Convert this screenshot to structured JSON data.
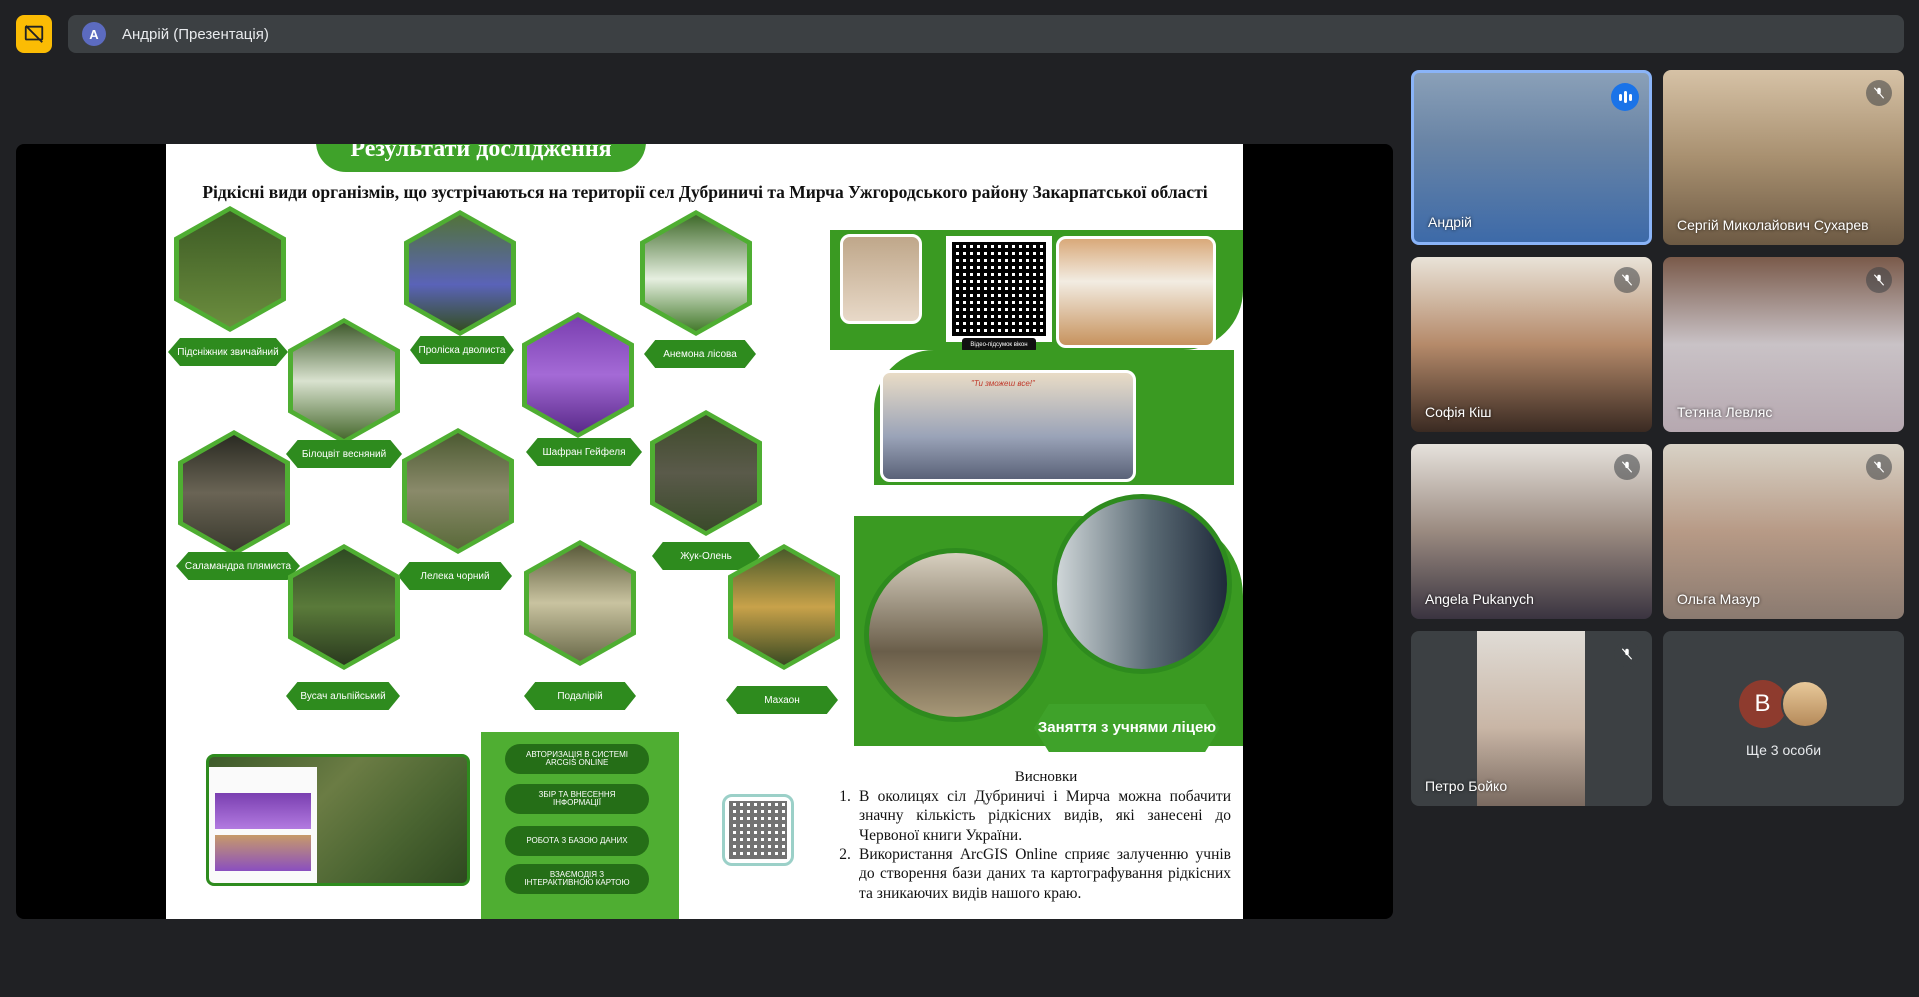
{
  "topbar": {
    "presenter_initial": "A",
    "presenter_label": "Андрій (Презентація)"
  },
  "slide": {
    "banner_text": "Результати дослідження",
    "title": "Рідкісні види організмів, що зустрічаються на території сел Дубриничі та Мирча Ужгородського району Закарпатської області",
    "species": [
      "Підсніжник звичайний",
      "Проліска дволиста",
      "Анемона лісова",
      "Білоцвіт весняний",
      "Шафран Гейфеля",
      "Саламандра плямиста",
      "Лелека чорний",
      "Жук-Олень",
      "Вусач альпійський",
      "Подалірій",
      "Махаон"
    ],
    "lesson_tag": "Заняття з учнями ліцею",
    "photo_caption": "\"Ти зможеш все!\"",
    "qr_caption": "Відео-підсумок вікон",
    "steps": [
      "АВТОРИЗАЦІЯ В СИСТЕМІ ARCGIS ONLINE",
      "ЗБІР ТА ВНЕСЕННЯ ІНФОРМАЦІЇ",
      "РОБОТА З БАЗОЮ ДАНИХ",
      "ВЗАЄМОДІЯ З ІНТЕРАКТИВНОЮ КАРТОЮ"
    ],
    "conclusions_title": "Висновки",
    "conclusions": [
      "В околицях сіл Дубриничі і Мирча можна побачити значну кількість рідкісних видів, які занесені до Червоної книги України.",
      "Використання ArcGIS Online сприяє залученню учнів до створення бази даних та картографування рідкісних та зникаючих видів нашого краю."
    ]
  },
  "participants": [
    {
      "name": "Андрій",
      "speaking": true
    },
    {
      "name": "Сергій Миколайович Сухарев",
      "muted": true
    },
    {
      "name": "Софія Кіш",
      "muted": true
    },
    {
      "name": "Тетяна Левляс",
      "muted": true
    },
    {
      "name": "Angela Pukanych",
      "muted": true
    },
    {
      "name": "Ольга Мазур",
      "muted": true
    },
    {
      "name": "Петро Бойко",
      "muted": true
    }
  ],
  "others": {
    "initial": "B",
    "label": "Ще 3 особи"
  },
  "colors": {
    "accent_yellow": "#fbbc04",
    "speaking_blue": "#1a73e8",
    "slide_green": "#3fa22a"
  }
}
